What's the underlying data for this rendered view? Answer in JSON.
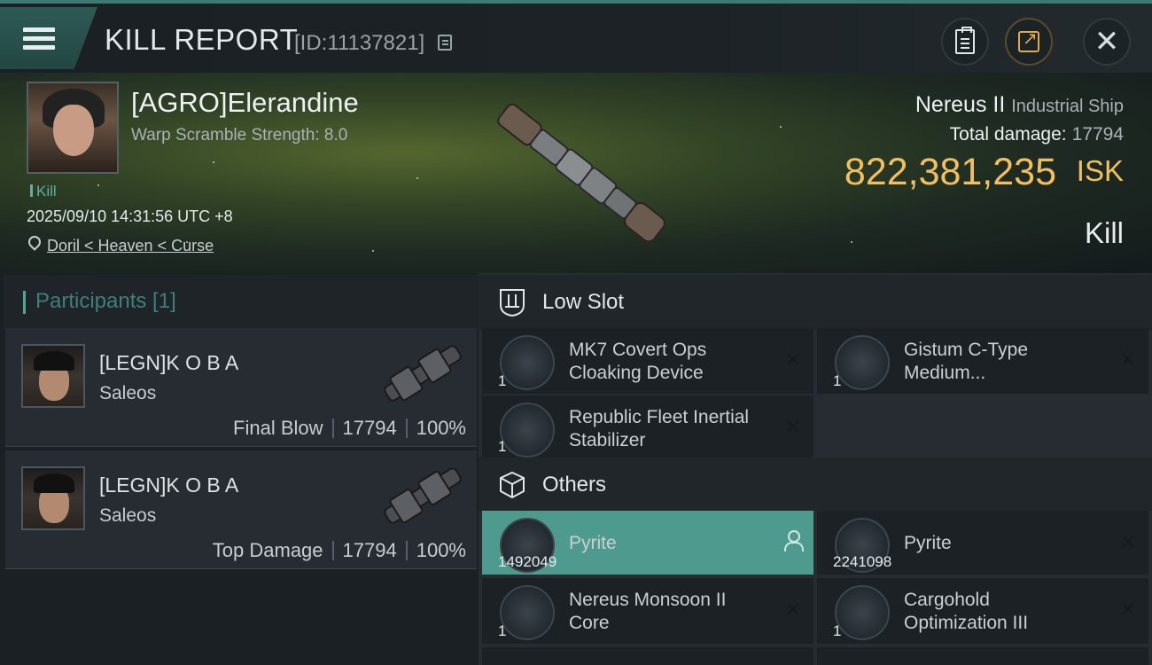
{
  "header": {
    "title": "KILL REPORT",
    "id_label": "[ID:11137821]"
  },
  "icons": {
    "menu": "hamburger-icon",
    "copy": "copy-icon",
    "clipboard": "clipboard-icon",
    "share": "share-icon",
    "close": "close-icon",
    "location": "location-pin-icon",
    "low_slot": "low-slot-icon",
    "others": "cube-icon",
    "assign": "person-icon"
  },
  "victim": {
    "pilot_name": "[AGRO]Elerandine",
    "warp_scramble": "Warp Scramble Strength: 8.0",
    "tag": "Kill",
    "datetime": "2025/09/10 14:31:56 UTC +8",
    "location": "Doril < Heaven < Curse",
    "ship_name": "Nereus II",
    "ship_class": "Industrial Ship",
    "total_damage_label": "Total damage:",
    "total_damage": "17794",
    "isk_value": "822,381,235",
    "isk_unit": "ISK",
    "result": "Kill"
  },
  "participants": {
    "title": "Participants [1]",
    "rows": [
      {
        "name": "[LEGN]K O B A",
        "ship": "Saleos",
        "role": "Final Blow",
        "damage": "17794",
        "percent": "100%"
      },
      {
        "name": "[LEGN]K O B A",
        "ship": "Saleos",
        "role": "Top Damage",
        "damage": "17794",
        "percent": "100%"
      }
    ]
  },
  "low_slot": {
    "title": "Low Slot",
    "items": [
      {
        "name_line1": "MK7 Covert Ops",
        "name_line2": "Cloaking Device",
        "qty": "1"
      },
      {
        "name_line1": "Gistum C-Type",
        "name_line2": "Medium...",
        "qty": "1"
      },
      {
        "name_line1": "Republic Fleet Inertial",
        "name_line2": "Stabilizer",
        "qty": "1"
      }
    ]
  },
  "others": {
    "title": "Others",
    "items": [
      {
        "name": "Pyrite",
        "qty": "1492049"
      },
      {
        "name": "Pyrite",
        "qty": "2241098"
      },
      {
        "name_line1": "Nereus Monsoon II",
        "name_line2": "Core",
        "qty": "1"
      },
      {
        "name_line1": "Cargohold",
        "name_line2": "Optimization III",
        "qty": "1"
      }
    ]
  },
  "colors": {
    "accent_teal": "#4f9a8f",
    "isk_gold": "#f0c060",
    "background": "#14181c"
  }
}
